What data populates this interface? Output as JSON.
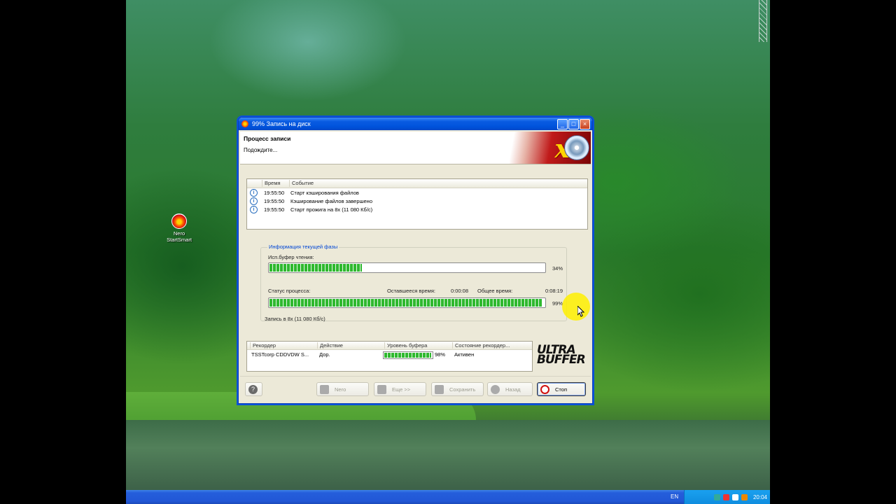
{
  "desktop": {
    "icon_label_line1": "Nero",
    "icon_label_line2": "StartSmart"
  },
  "taskbar": {
    "language": "EN",
    "clock": "20:04"
  },
  "window": {
    "title": "99% Запись на диск",
    "header_title": "Процесс записи",
    "header_subtitle": "Подождите..."
  },
  "log": {
    "columns": [
      "Время",
      "Событие"
    ],
    "rows": [
      {
        "time": "19:55:50",
        "event": "Старт кэширования файлов"
      },
      {
        "time": "19:55:50",
        "event": "Кэширование файлов завершено"
      },
      {
        "time": "19:55:50",
        "event": "Старт прожига на 8x (11 080 Кб/с)"
      }
    ]
  },
  "phase": {
    "title": "Информация текущей фазы",
    "read_buffer_label": "Исп.буфер чтения:",
    "read_buffer_pct": "34%",
    "read_buffer_value": 0.34,
    "status_label": "Статус процесса:",
    "remaining_label": "Оставшееся время:",
    "remaining_value": "0:00:08",
    "total_label": "Общее время:",
    "total_value": "0:08:19",
    "progress_pct": "99%",
    "progress_value": 0.99,
    "speed_text": "Запись в 8x (11 080 Кб/с)"
  },
  "recorder": {
    "columns": [
      "Рекордер",
      "Действие",
      "Уровень буфера",
      "Состояние рекордер..."
    ],
    "row": {
      "recorder": "TSSTcorp CDDVDW S...",
      "action": "Дор.",
      "buffer_pct": "98%",
      "buffer_value": 0.98,
      "state": "Активен"
    },
    "logo_line1": "ULTRA",
    "logo_line2": "BUFFER"
  },
  "buttons": {
    "help": "?",
    "nero": "Nero",
    "more": "Еще >>",
    "save": "Сохранить",
    "back": "Назад",
    "stop": "Стоп"
  }
}
